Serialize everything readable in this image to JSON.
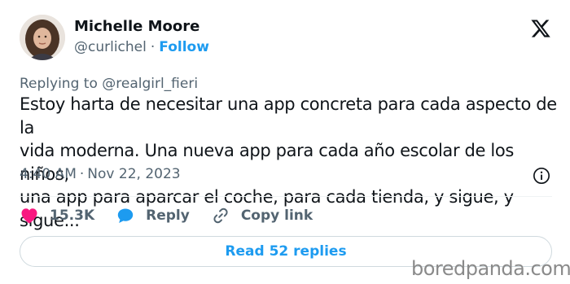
{
  "user": {
    "name": "Michelle Moore",
    "handle": "@curlichel",
    "separator": "·",
    "follow_label": "Follow"
  },
  "replying": {
    "text": "Replying to @realgirl_fieri"
  },
  "tweet": {
    "text": "Estoy harta de necesitar una app concreta para cada aspecto de la\nvida moderna. Una nueva app para cada año escolar de los niños,\nuna app para aparcar el coche, para cada tienda, y sigue, y sigue..."
  },
  "meta": {
    "time": "4:40 AM",
    "separator": "·",
    "date": "Nov 22, 2023"
  },
  "actions": {
    "likes": "15.3K",
    "reply_label": "Reply",
    "copy_label": "Copy link"
  },
  "read_replies_label": "Read 52 replies",
  "watermark": "boredpanda.com",
  "icons": {
    "logo": "x-logo-icon",
    "info": "info-icon",
    "like": "heart-icon",
    "reply": "speech-bubble-icon",
    "copy": "link-icon"
  },
  "colors": {
    "accent": "#1d9bf0",
    "like": "#f91880",
    "text": "#0f1419",
    "secondary": "#536471"
  }
}
